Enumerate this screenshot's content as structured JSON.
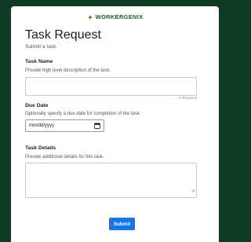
{
  "brand": {
    "name": "WORKERGENIX",
    "color": "#1c5c2b"
  },
  "form": {
    "title": "Task Request",
    "subtitle": "Submit a task.",
    "task_name": {
      "label": "Task Name",
      "help": "Provide high level description of the task.",
      "value": "",
      "required_note": "✶ Required"
    },
    "due_date": {
      "label": "Due Date",
      "help": "Optionally specify a due date for completion of the task.",
      "placeholder": "mm/dd/yyyy"
    },
    "task_details": {
      "label": "Task Details",
      "help": "Provide additional details for this task.",
      "value": ""
    },
    "submit_label": "Submit"
  },
  "colors": {
    "page_bg": "#0d3a22",
    "accent": "#1a73e8"
  }
}
